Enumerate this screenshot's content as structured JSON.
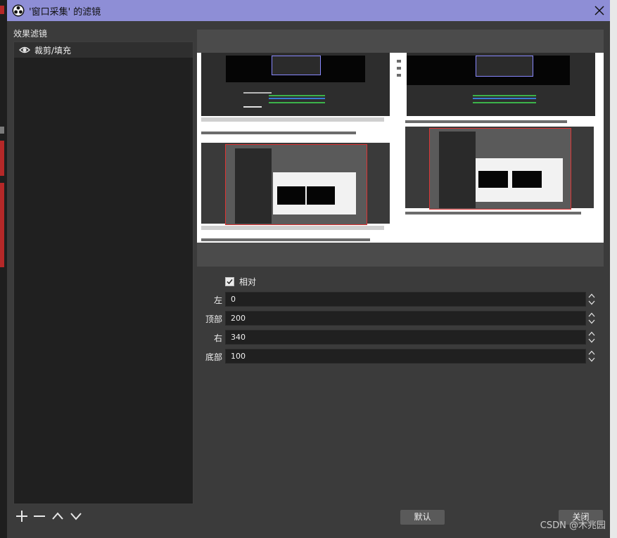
{
  "window": {
    "title": "'窗口采集' 的滤镜"
  },
  "filters": {
    "label": "效果滤镜",
    "items": [
      {
        "name": "裁剪/填充",
        "visible": true
      }
    ]
  },
  "toolbar": {
    "add": "add-filter",
    "remove": "remove-filter",
    "up": "move-up",
    "down": "move-down"
  },
  "crop": {
    "relative_label": "相对",
    "relative_checked": true,
    "fields": [
      {
        "label": "左",
        "value": "0"
      },
      {
        "label": "顶部",
        "value": "200"
      },
      {
        "label": "右",
        "value": "340"
      },
      {
        "label": "底部",
        "value": "100"
      }
    ]
  },
  "buttons": {
    "defaults": "默认",
    "close": "关闭"
  },
  "watermark": "CSDN @木兆园",
  "colors": {
    "titlebar": "#8e8ed6",
    "panel": "#3b3b3b",
    "list": "#202020"
  }
}
